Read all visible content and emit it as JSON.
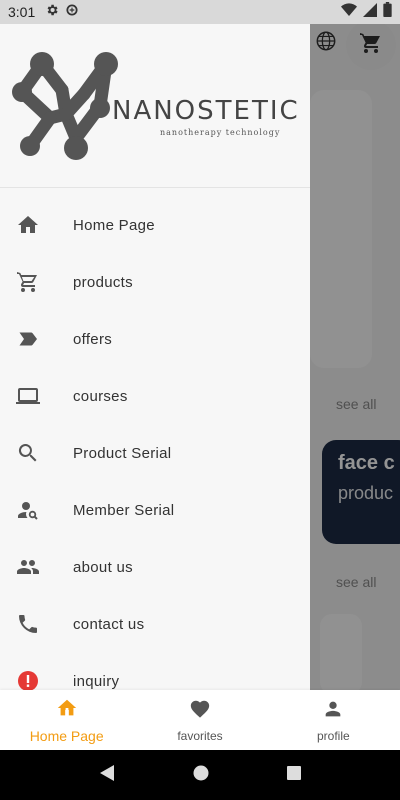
{
  "status_bar": {
    "time": "3:01",
    "icons": [
      "settings-icon",
      "data-saver-icon",
      "wifi-icon",
      "signal-icon",
      "battery-icon"
    ]
  },
  "background": {
    "see_all_1": "see all",
    "see_all_2": "see all",
    "promo_title": "face c",
    "promo_subtitle": "produc",
    "icons": [
      "globe-icon",
      "cart-icon"
    ]
  },
  "drawer": {
    "brand": {
      "name": "NANOSTETIC",
      "tagline": "nanotherapy technology"
    },
    "items": [
      {
        "label": "Home Page",
        "icon": "home-icon"
      },
      {
        "label": "products",
        "icon": "cart-icon"
      },
      {
        "label": "offers",
        "icon": "label-icon"
      },
      {
        "label": "courses",
        "icon": "laptop-icon"
      },
      {
        "label": "Product Serial",
        "icon": "search-icon"
      },
      {
        "label": "Member Serial",
        "icon": "person-search-icon"
      },
      {
        "label": "about us",
        "icon": "people-icon"
      },
      {
        "label": "contact us",
        "icon": "phone-icon"
      },
      {
        "label": "inquiry",
        "icon": "alert-icon"
      }
    ]
  },
  "bottom_nav": {
    "tabs": [
      {
        "label": "Home Page",
        "icon": "home-icon",
        "active": true
      },
      {
        "label": "favorites",
        "icon": "heart-icon",
        "active": false
      },
      {
        "label": "profile",
        "icon": "person-icon",
        "active": false
      }
    ]
  },
  "colors": {
    "accent": "#f39c12",
    "alert": "#e53935",
    "promo_bg": "#1c2a44"
  }
}
